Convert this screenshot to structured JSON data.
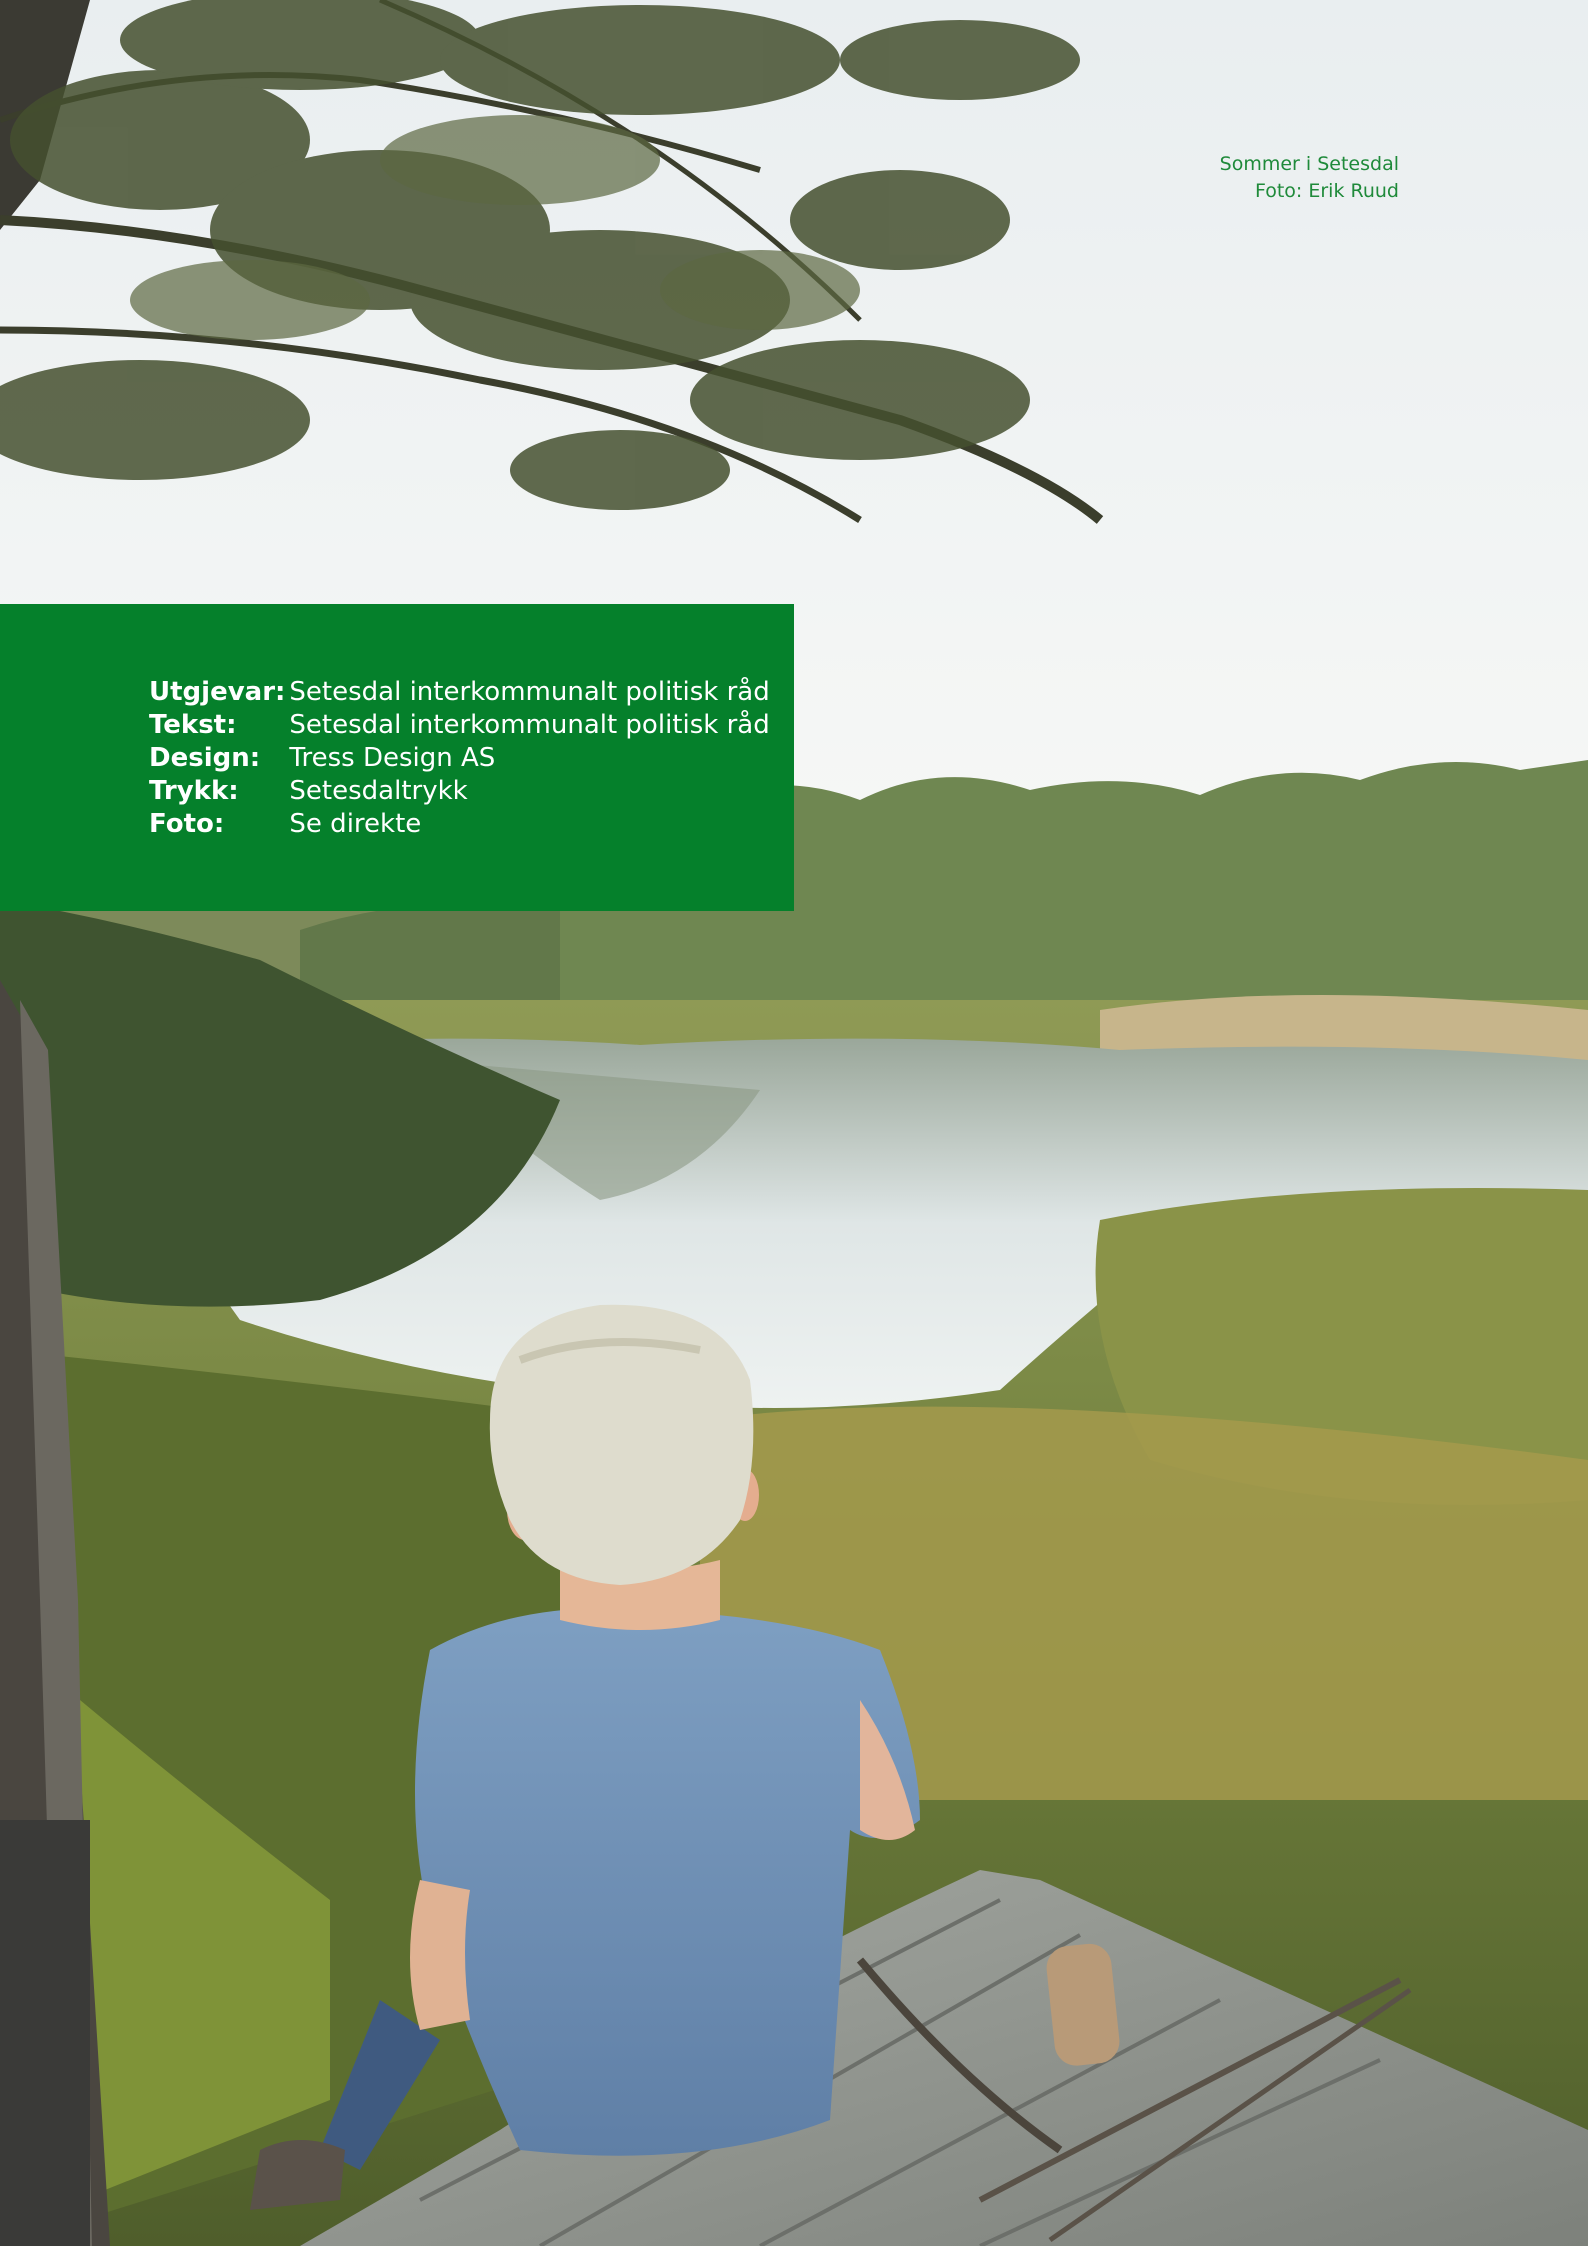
{
  "caption": {
    "line1": "Sommer i Setesdal",
    "line2": "Foto: Erik Ruud"
  },
  "credits": [
    {
      "label": "Utgjevar:",
      "value": "Setesdal interkommunalt politisk råd"
    },
    {
      "label": "Tekst:",
      "value": "Setesdal interkommunalt politisk råd"
    },
    {
      "label": "Design:",
      "value": "Tress Design AS"
    },
    {
      "label": "Trykk:",
      "value": "Setesdaltrykk"
    },
    {
      "label": "Foto:",
      "value": "Se direkte"
    }
  ],
  "colors": {
    "panel_green": "#05802b",
    "caption_green": "#1f8a3a",
    "panel_text": "#ffffff"
  },
  "photo": {
    "icon": "landscape-photo-boy-by-lake"
  }
}
